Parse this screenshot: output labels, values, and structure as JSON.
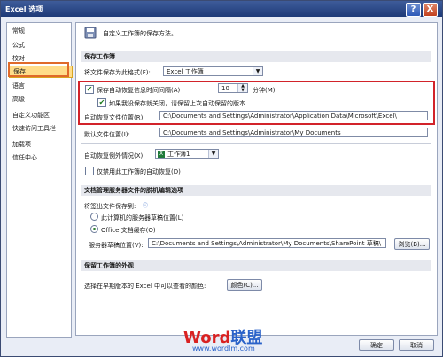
{
  "window": {
    "title": "Excel 选项",
    "help": "?",
    "close": "X"
  },
  "sidebar": {
    "items": [
      {
        "label": "常规"
      },
      {
        "label": "公式"
      },
      {
        "label": "校对"
      },
      {
        "label": "保存"
      },
      {
        "label": "语言"
      },
      {
        "label": "高级"
      },
      {
        "label": "自定义功能区"
      },
      {
        "label": "快速访问工具栏"
      },
      {
        "label": "加载项"
      },
      {
        "label": "信任中心"
      }
    ]
  },
  "header": {
    "text": "自定义工作簿的保存方法。"
  },
  "save_workbooks": {
    "section_title": "保存工作簿",
    "format_label": "将文件保存为此格式(F):",
    "format_value": "Excel 工作簿",
    "autorecover_label": "保存自动恢复信息时间间隔(A)",
    "autorecover_minutes": "10",
    "minutes_label": "分钟(M)",
    "keep_last_label": "如果我没保存就关闭，请保留上次自动保留的版本",
    "autorecover_location_label": "自动恢复文件位置(R):",
    "autorecover_location_value": "C:\\Documents and Settings\\Administrator\\Application Data\\Microsoft\\Excel\\",
    "default_location_label": "默认文件位置(I):",
    "default_location_value": "C:\\Documents and Settings\\Administrator\\My Documents"
  },
  "autorecover_exceptions": {
    "label": "自动恢复例外情况(X):",
    "workbook_value": "工作簿1",
    "disable_label": "仅禁用此工作簿的自动恢复(D)"
  },
  "offline_editing": {
    "section_title": "文档管理服务器文件的脱机编辑选项",
    "save_to_label": "将签出文件保存到:",
    "option_server": "此计算机的服务器草稿位置(L)",
    "option_office": "Office 文档缓存(O)",
    "drafts_label": "服务器草稿位置(V):",
    "drafts_value": "C:\\Documents and Settings\\Administrator\\My Documents\\SharePoint 草稿\\",
    "browse_button": "浏览(B)..."
  },
  "appearance": {
    "section_title": "保留工作簿的外观",
    "colors_label": "选择在早期版本的 Excel 中可以查看的颜色:",
    "colors_button": "颜色(C)..."
  },
  "footer": {
    "ok": "确定",
    "cancel": "取消"
  },
  "watermark": {
    "brand_a": "Word",
    "brand_b": "联盟",
    "url": "www.wordlm.com"
  },
  "colors": {
    "highlight_red": "#d2232a",
    "selected_item": "#ffdd8a"
  }
}
